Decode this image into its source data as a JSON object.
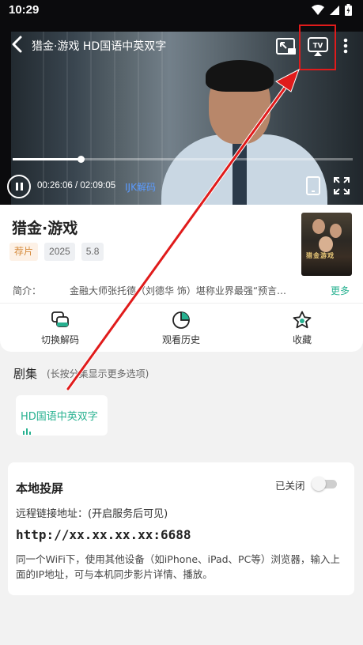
{
  "status_bar": {
    "time": "10:29"
  },
  "player": {
    "title": "猎金·游戏 HD国语中英双字",
    "current_time": "00:26:06",
    "duration": "02:09:05",
    "time_separator": " / ",
    "progress_fraction": 0.2,
    "decoder": "IJK解码"
  },
  "movie": {
    "title": "猎金·游戏",
    "tags": [
      "荐片",
      "2025",
      "5.8"
    ],
    "poster_text": "猎金游戏",
    "synopsis_label": "简介：",
    "synopsis": "金融大师张托德（刘德华 饰）堪称业界最强“预言…",
    "synopsis_more": "更多"
  },
  "actions": [
    {
      "label": "切换解码",
      "icon": "switch-decoder-icon"
    },
    {
      "label": "观看历史",
      "icon": "pie-chart-icon"
    },
    {
      "label": "收藏",
      "icon": "star-icon"
    }
  ],
  "episodes": {
    "heading": "剧集",
    "hint": "(长按分集显示更多选项)",
    "items": [
      {
        "label": "HD国语中英双字",
        "playing": true
      }
    ]
  },
  "local_cast": {
    "title": "本地投屏",
    "status": "已关闭",
    "enabled": false,
    "address_label": "远程链接地址：(开启服务后可见)",
    "address": "http://xx.xx.xx.xx:6688",
    "description": "同一个WiFi下，使用其他设备（如iPhone、iPad、PC等）浏览器，输入上面的IP地址，可与本机同步影片详情、播放。"
  },
  "colors": {
    "accent": "#27b190",
    "highlight": "#e01b1b",
    "link_blue": "#5b9bff"
  }
}
